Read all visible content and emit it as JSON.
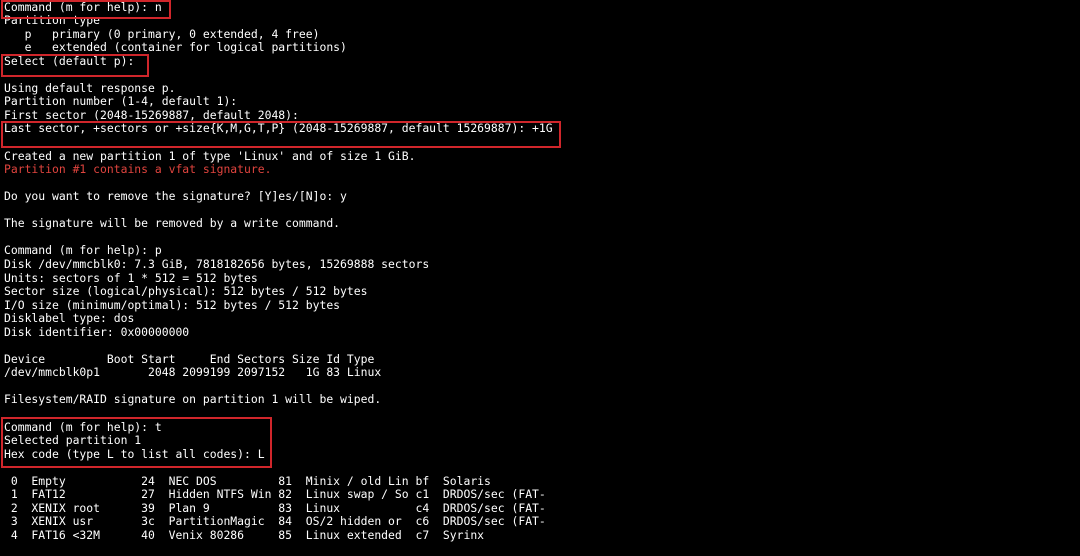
{
  "terminal": {
    "text_color": "#ffffff",
    "warning_color": "#e0443e",
    "highlight_color": "#d0262b",
    "background": "#000000",
    "lines": [
      "Command (m for help): n",
      "Partition type",
      "   p   primary (0 primary, 0 extended, 4 free)",
      "   e   extended (container for logical partitions)",
      "Select (default p):",
      "",
      "Using default response p.",
      "Partition number (1-4, default 1):",
      "First sector (2048-15269887, default 2048):",
      "Last sector, +sectors or +size{K,M,G,T,P} (2048-15269887, default 15269887): +1G",
      "",
      "Created a new partition 1 of type 'Linux' and of size 1 GiB.",
      "Partition #1 contains a vfat signature.",
      "",
      "Do you want to remove the signature? [Y]es/[N]o: y",
      "",
      "The signature will be removed by a write command.",
      "",
      "Command (m for help): p",
      "Disk /dev/mmcblk0: 7.3 GiB, 7818182656 bytes, 15269888 sectors",
      "Units: sectors of 1 * 512 = 512 bytes",
      "Sector size (logical/physical): 512 bytes / 512 bytes",
      "I/O size (minimum/optimal): 512 bytes / 512 bytes",
      "Disklabel type: dos",
      "Disk identifier: 0x00000000",
      "",
      "Device         Boot Start     End Sectors Size Id Type",
      "/dev/mmcblk0p1       2048 2099199 2097152   1G 83 Linux",
      "",
      "Filesystem/RAID signature on partition 1 will be wiped.",
      "",
      "Command (m for help): t",
      "Selected partition 1",
      "Hex code (type L to list all codes): L",
      "",
      " 0  Empty           24  NEC DOS         81  Minix / old Lin bf  Solaris",
      " 1  FAT12           27  Hidden NTFS Win 82  Linux swap / So c1  DRDOS/sec (FAT-",
      " 2  XENIX root      39  Plan 9          83  Linux           c4  DRDOS/sec (FAT-",
      " 3  XENIX usr       3c  PartitionMagic  84  OS/2 hidden or  c6  DRDOS/sec (FAT-",
      " 4  FAT16 <32M      40  Venix 80286     85  Linux extended  c7  Syrinx"
    ]
  }
}
